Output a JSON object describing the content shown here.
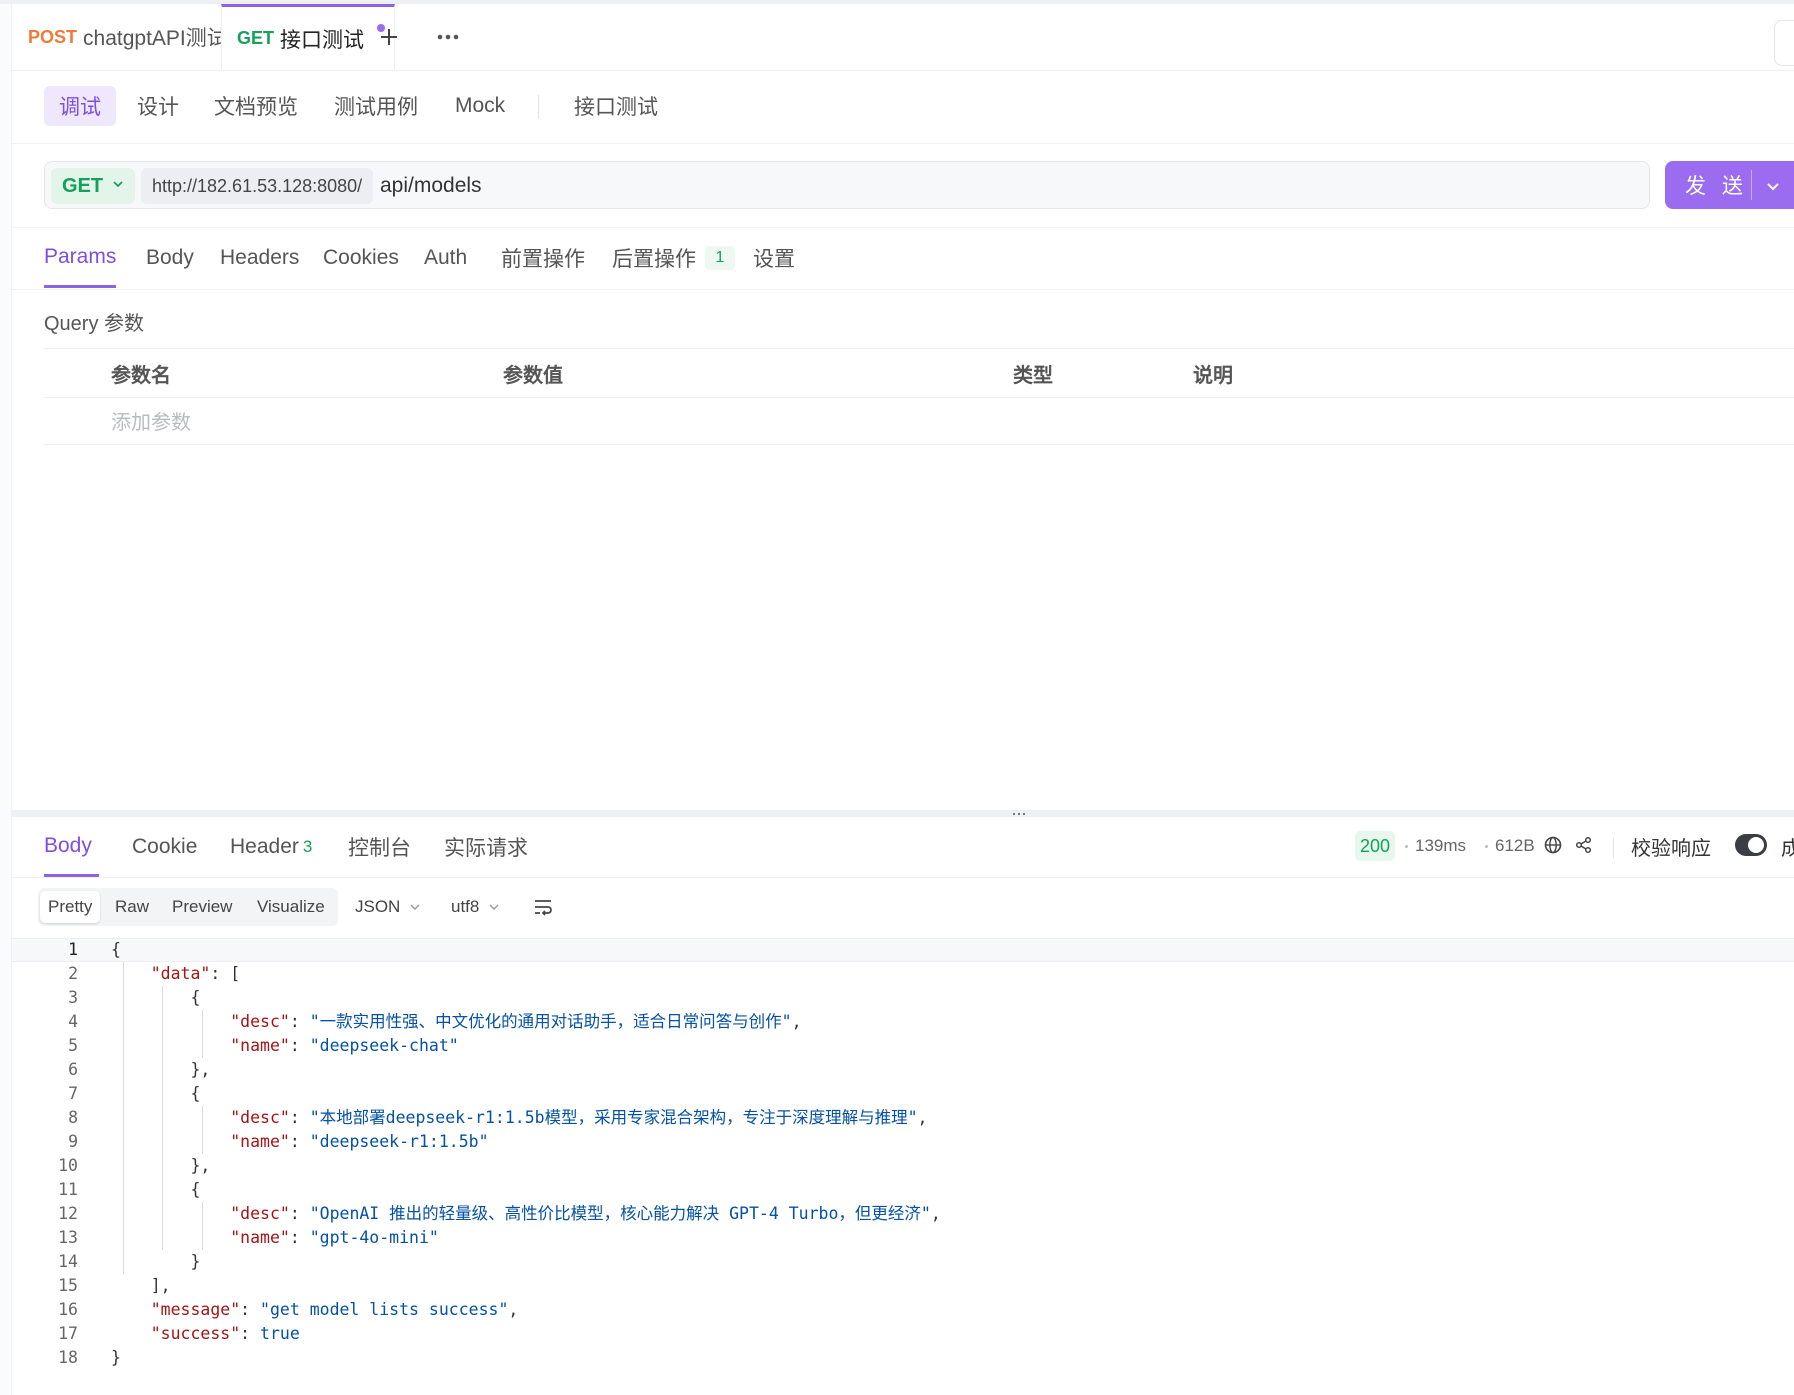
{
  "request_tabs": [
    {
      "method": "POST",
      "title": "chatgptAPI测试"
    },
    {
      "method": "GET",
      "title": "接口测试"
    }
  ],
  "sub_tabs": [
    "调试",
    "设计",
    "文档预览",
    "测试用例",
    "Mock",
    "接口测试"
  ],
  "url_bar": {
    "method": "GET",
    "base_url": "http://182.61.53.128:8080/",
    "path": "api/models",
    "send_label": "发 送"
  },
  "params_tabs": [
    {
      "label": "Params"
    },
    {
      "label": "Body"
    },
    {
      "label": "Headers"
    },
    {
      "label": "Cookies"
    },
    {
      "label": "Auth"
    },
    {
      "label": "前置操作"
    },
    {
      "label": "后置操作",
      "badge": "1"
    },
    {
      "label": "设置"
    }
  ],
  "query": {
    "label": "Query 参数",
    "columns": [
      "参数名",
      "参数值",
      "类型",
      "说明"
    ],
    "add_placeholder": "添加参数"
  },
  "response": {
    "tabs": [
      {
        "label": "Body"
      },
      {
        "label": "Cookie"
      },
      {
        "label": "Header",
        "count": "3"
      },
      {
        "label": "控制台"
      },
      {
        "label": "实际请求"
      }
    ],
    "status": "200",
    "time": "139ms",
    "size": "612B",
    "verify_label": "校验响应",
    "verify_on": true,
    "result_label": "成功"
  },
  "viewer": {
    "formats": [
      "Pretty",
      "Raw",
      "Preview",
      "Visualize"
    ],
    "active_format": "Pretty",
    "type": "JSON",
    "encoding": "utf8"
  },
  "code_lines": [
    "{",
    "    \"data\": [",
    "        {",
    "            \"desc\": \"一款实用性强、中文优化的通用对话助手，适合日常问答与创作\",",
    "            \"name\": \"deepseek-chat\"",
    "        },",
    "        {",
    "            \"desc\": \"本地部署deepseek-r1:1.5b模型，采用专家混合架构，专注于深度理解与推理\",",
    "            \"name\": \"deepseek-r1:1.5b\"",
    "        },",
    "        {",
    "            \"desc\": \"OpenAI 推出的轻量级、高性价比模型，核心能力解决 GPT-4 Turbo，但更经济\",",
    "            \"name\": \"gpt-4o-mini\"",
    "        }",
    "    ],",
    "    \"message\": \"get model lists success\",",
    "    \"success\": true",
    "}"
  ],
  "colors": {
    "accent": "#8b63e6",
    "get": "#17a05a",
    "post": "#f07a3a",
    "json_key": "#a31515",
    "json_string": "#0451a5"
  }
}
